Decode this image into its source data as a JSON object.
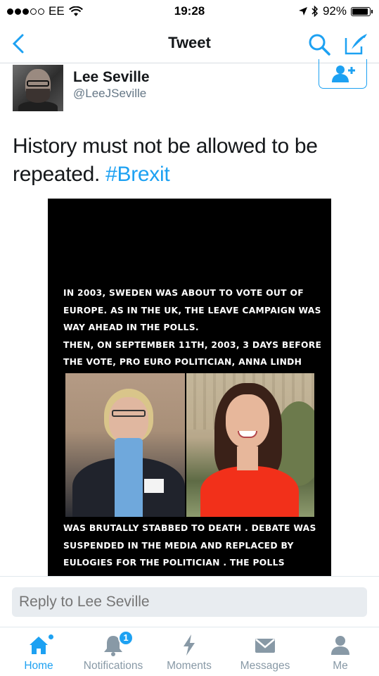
{
  "status_bar": {
    "carrier": "EE",
    "time": "19:28",
    "battery": "92%",
    "battery_level": 0.92,
    "signal_bars_filled": 3,
    "signal_bars_total": 5
  },
  "nav": {
    "title": "Tweet",
    "back_icon": "chevron-left-icon",
    "search_icon": "search-icon",
    "compose_icon": "compose-icon"
  },
  "tweet": {
    "display_name": "Lee Seville",
    "handle": "@LeeJSeville",
    "text": "History must not be allowed to be repeated. ",
    "hashtag": "#Brexit",
    "follow_icon": "add-user-icon"
  },
  "media": {
    "text_top": [
      "IN 2003, SWEDEN WAS ABOUT TO VOTE OUT OF",
      "EUROPE. AS IN THE UK, THE LEAVE CAMPAIGN WAS",
      "WAY AHEAD IN THE POLLS.",
      "THEN, ON SEPTEMBER 11TH, 2003, 3 DAYS BEFORE",
      "THE VOTE, PRO EURO POLITICIAN, ANNA LINDH"
    ],
    "text_bottom": [
      "WAS BRUTALLY STABBED TO DEATH . DEBATE WAS",
      "SUSPENDED IN THE MEDIA AND REPLACED BY",
      "EULOGIES FOR THE POLITICIAN . THE POLLS"
    ]
  },
  "reply": {
    "placeholder": "Reply to Lee Seville"
  },
  "tabs": [
    {
      "label": "Home",
      "icon": "home-icon",
      "active": true
    },
    {
      "label": "Notifications",
      "icon": "bell-icon",
      "badge": "1"
    },
    {
      "label": "Moments",
      "icon": "lightning-icon"
    },
    {
      "label": "Messages",
      "icon": "envelope-icon"
    },
    {
      "label": "Me",
      "icon": "person-icon"
    }
  ],
  "colors": {
    "accent": "#1da1f2",
    "inactive": "#8899a6",
    "text": "#14171a",
    "secondary": "#657786"
  }
}
